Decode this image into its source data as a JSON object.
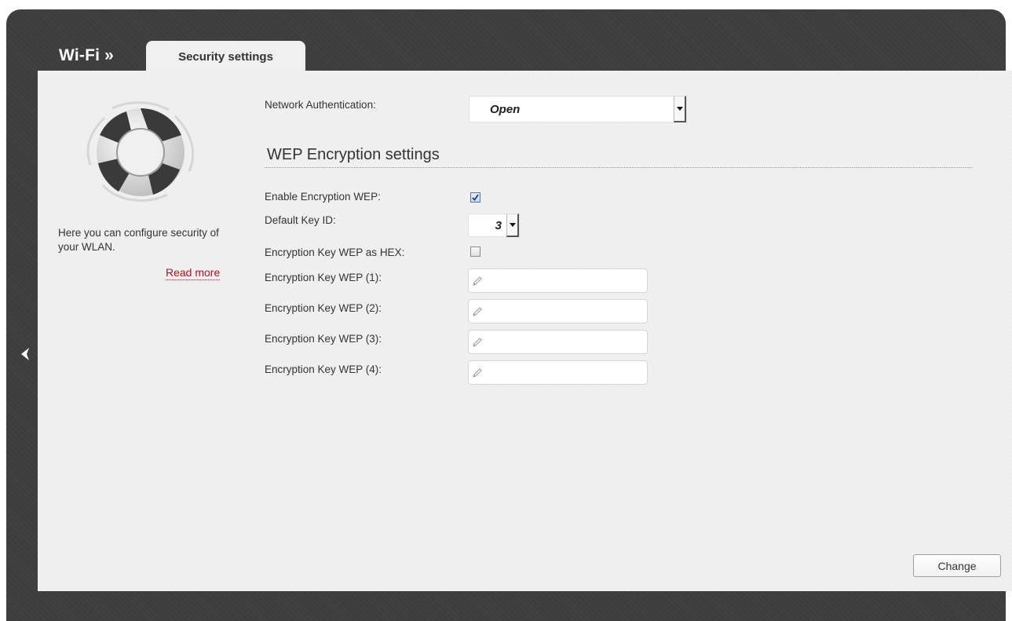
{
  "header": {
    "section_title": "Wi-Fi »",
    "active_tab": "Security settings"
  },
  "sidebar": {
    "icon": "lifebuoy-icon",
    "help_text": "Here you can configure security of your WLAN.",
    "read_more": "Read more"
  },
  "form": {
    "network_authentication": {
      "label": "Network Authentication:",
      "value": "Open"
    },
    "wep_section_title": "WEP Encryption settings",
    "enable_wep": {
      "label": "Enable Encryption WEP:",
      "checked": true
    },
    "default_key_id": {
      "label": "Default Key ID:",
      "value": "3"
    },
    "key_as_hex": {
      "label": "Encryption Key WEP as HEX:",
      "checked": false
    },
    "keys": [
      {
        "label": "Encryption Key WEP (1):",
        "value": ""
      },
      {
        "label": "Encryption Key WEP (2):",
        "value": ""
      },
      {
        "label": "Encryption Key WEP (3):",
        "value": ""
      },
      {
        "label": "Encryption Key WEP (4):",
        "value": ""
      }
    ]
  },
  "actions": {
    "change": "Change"
  },
  "colors": {
    "frame": "#3d3d3d",
    "panel": "#f0f0f0",
    "link": "#c20e1a"
  }
}
